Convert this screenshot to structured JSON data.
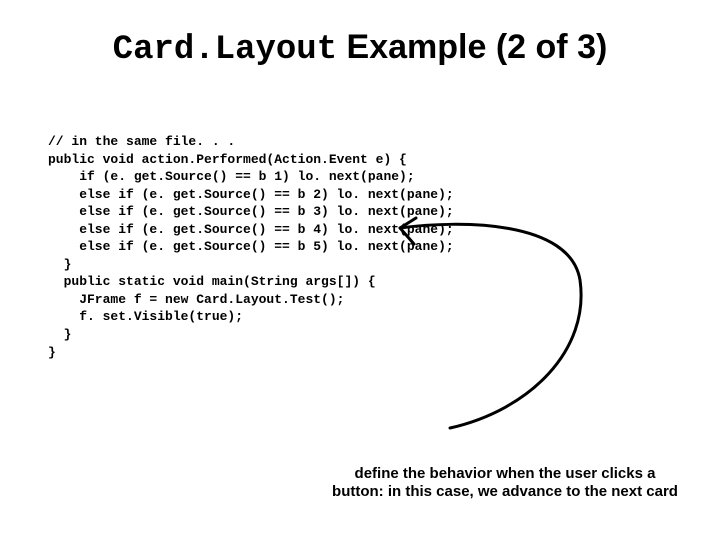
{
  "title": {
    "mono": "Card.Layout",
    "rest": " Example (2 of 3)"
  },
  "code": "// in the same file. . .\npublic void action.Performed(Action.Event e) {\n    if (e. get.Source() == b 1) lo. next(pane);\n    else if (e. get.Source() == b 2) lo. next(pane);\n    else if (e. get.Source() == b 3) lo. next(pane);\n    else if (e. get.Source() == b 4) lo. next(pane);\n    else if (e. get.Source() == b 5) lo. next(pane);\n  }\n  public static void main(String args[]) {\n    JFrame f = new Card.Layout.Test();\n    f. set.Visible(true);\n  }\n}",
  "caption": "define the behavior when the user clicks a button: in this case, we advance to the next card"
}
